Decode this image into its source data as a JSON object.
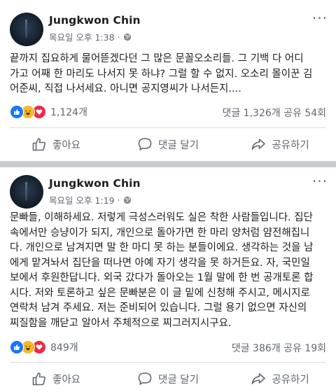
{
  "posts": [
    {
      "author": "Jungkwon Chin",
      "timestamp": "목요일 오후 1:38",
      "privacy_icon": "globe-icon",
      "more": "···",
      "lines": [
        "끝까지 집요하게 물어뜯겠다던 그 많은 문꼴오소리들. 그 기백 다 어디",
        "가고 어째 한 마리도 나서지 못 하냐? 그럴 할 수 없지. 오소리 몰이꾼 김",
        "어준씨, 직접 나서세요. 아니면 공지영씨가 나서든지...."
      ],
      "reaction_count": "1,124개",
      "stats": "댓글 1,326개  공유 54회",
      "actions": {
        "like": "좋아요",
        "comment": "댓글 달기",
        "share": "공유하기"
      }
    },
    {
      "author": "Jungkwon Chin",
      "timestamp": "목요일 오후 1:19",
      "privacy_icon": "globe-icon",
      "more": "···",
      "lines": [
        "문빠들, 이해하세요. 저렇게 극성스러워도 실은 착한 사람들입니다. 집단",
        "속에서만 승냥이가 되지, 개인으로 돌아가면 한 마리 양처럼 얌전해집니",
        "다. 개인으로 남겨지면 말 한 마디 못 하는 분들이에요. 생각하는 것을 남",
        "에게 맡겨놔서 집단을 떠나면 아예 자기 생각을 못 하거든요. 자, 국민일",
        "보에서 후원한답니다. 외국 갔다가 돌아오는 1월 말에 한 번 공개토론 합",
        "시다. 저와 토론하고 싶은 문빠분은 이 글 밑에 신청해 주시고, 메시지로",
        "연락처 남겨 주세요. 저는 준비되어 있습니다. 그럴 용기 없으면 자신의",
        "찌질함을 깨닫고 알아서 주체적으로 찌그러지시구요."
      ],
      "reaction_count": "849개",
      "stats": "댓글 386개  공유 19회",
      "actions": {
        "like": "좋아요",
        "comment": "댓글 달기",
        "share": "공유하기"
      }
    }
  ],
  "colors": {
    "like": "#1877f2",
    "haha": "#f7b928",
    "love": "#f02849",
    "text": "#1c1e21",
    "muted": "#606770"
  }
}
